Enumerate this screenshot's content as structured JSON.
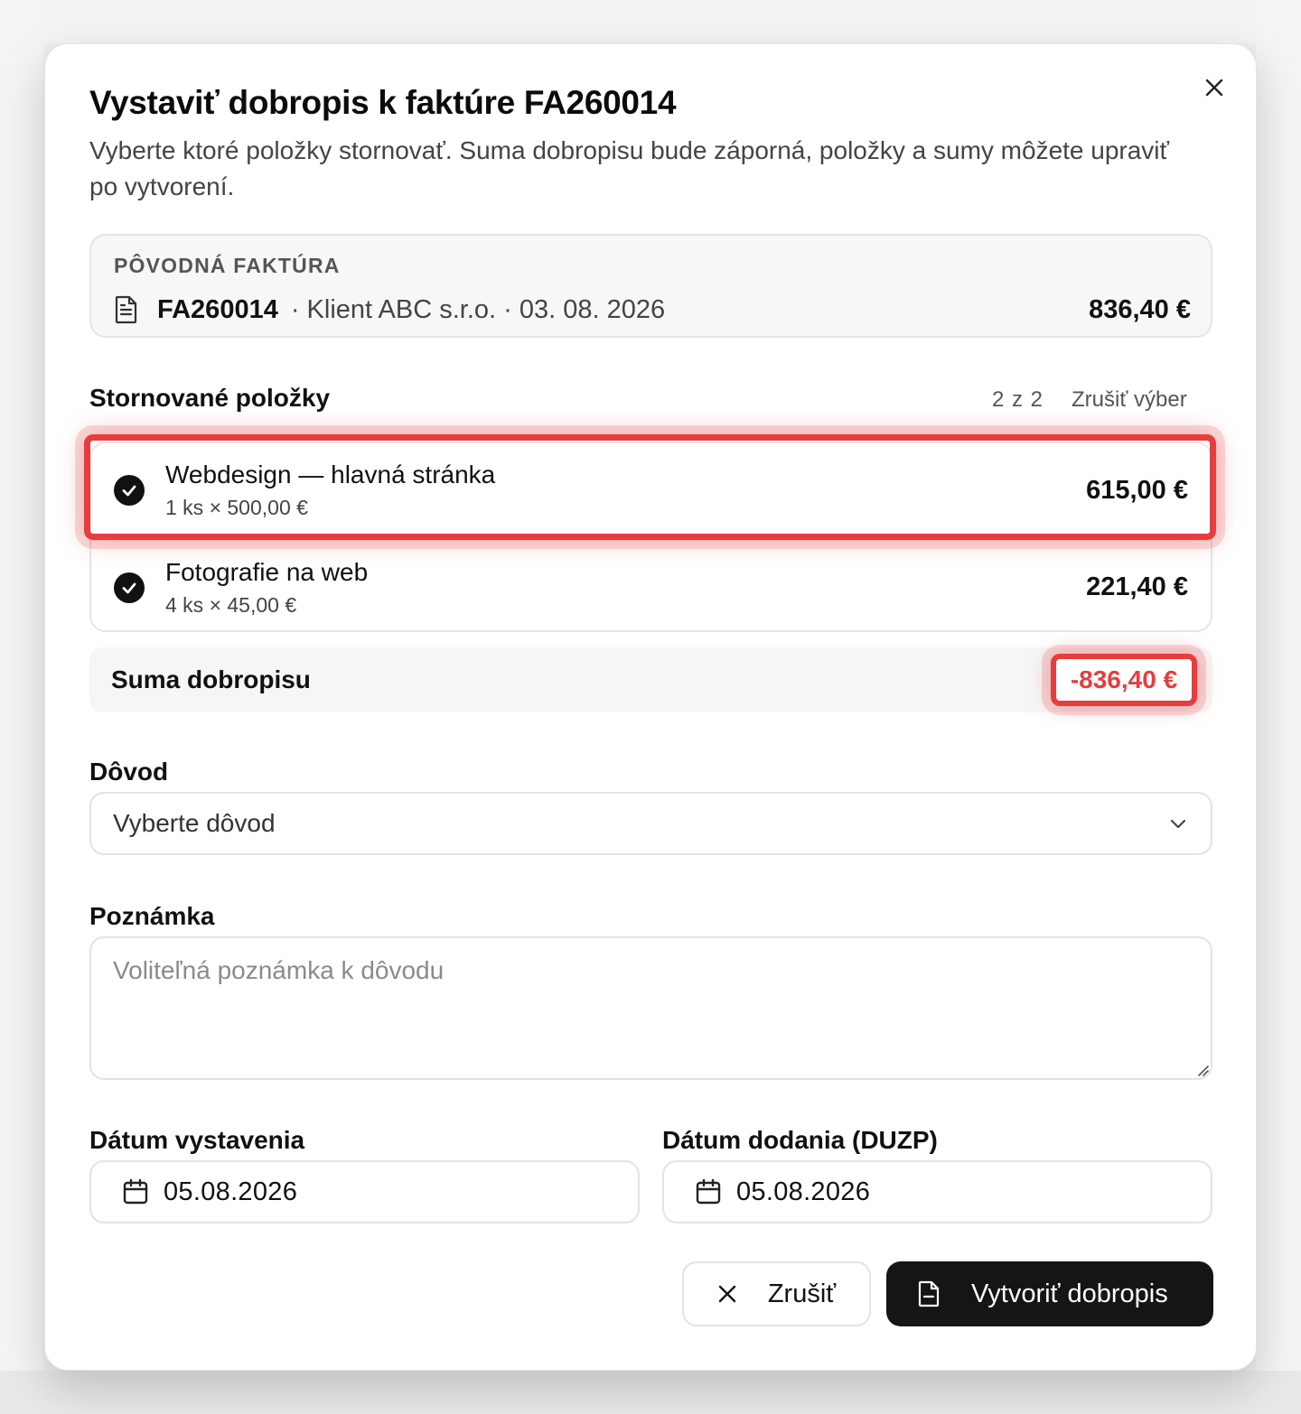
{
  "dialog": {
    "title": "Vystaviť dobropis k faktúre FA260014",
    "subtitle": "Vyberte ktoré položky stornovať. Suma dobropisu bude záporná, položky a sumy môžete upraviť po vytvorení.",
    "close_icon": "close-icon"
  },
  "original_invoice": {
    "label": "PÔVODNÁ FAKTÚRA",
    "number": "FA260014",
    "meta": "· Klient ABC s.r.o. · 03. 08. 2026",
    "amount": "836,40 €",
    "icon": "document-icon"
  },
  "cancelled_items": {
    "title": "Stornované položky",
    "count": "2 z 2",
    "clear_selection": "Zrušiť výber",
    "items": [
      {
        "name": "Webdesign — hlavná stránka",
        "qty": "1 ks × 500,00 €",
        "amount": "615,00 €",
        "checked": true
      },
      {
        "name": "Fotografie na web",
        "qty": "4 ks × 45,00 €",
        "amount": "221,40 €",
        "checked": true
      }
    ]
  },
  "credit_sum": {
    "label": "Suma dobropisu",
    "value": "-836,40 €"
  },
  "reason": {
    "label": "Dôvod",
    "value": "Vyberte dôvod"
  },
  "note": {
    "label": "Poznámka",
    "placeholder": "Voliteľná poznámka k dôvodu"
  },
  "dates": {
    "issue_label": "Dátum vystavenia",
    "issue_value": "05.08.2026",
    "delivery_label": "Dátum dodania (DUZP)",
    "delivery_value": "05.08.2026"
  },
  "actions": {
    "cancel": "Zrušiť",
    "create": "Vytvoriť dobropis"
  },
  "colors": {
    "accent_red": "#e53e3e",
    "primary_button": "#151515"
  }
}
